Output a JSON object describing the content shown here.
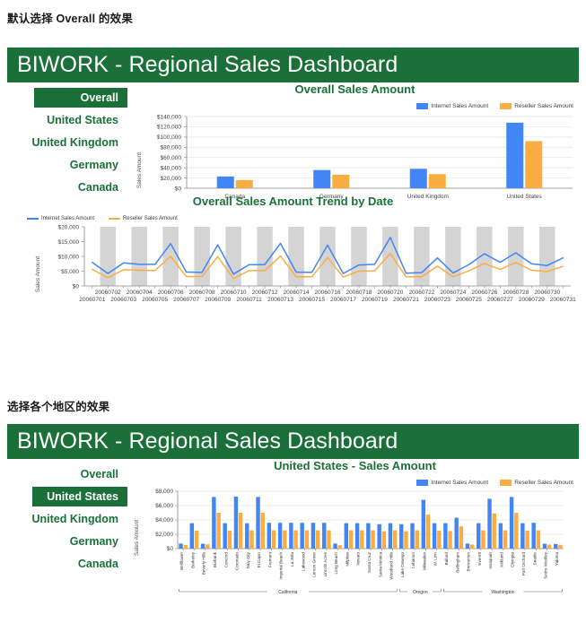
{
  "captions": {
    "first": "默认选择 Overall 的效果",
    "second": "选择各个地区的效果"
  },
  "dashboard_title": "BIWORK - Regional Sales Dashboard",
  "colors": {
    "brand_green": "#1a7038",
    "internet_blue": "#4285f4",
    "reseller_orange": "#fbad41",
    "band_gray": "#d4d4d4"
  },
  "nav": {
    "items": [
      "Overall",
      "United States",
      "United Kingdom",
      "Germany",
      "Canada"
    ],
    "selected_first": "Overall",
    "selected_second": "United States"
  },
  "legend": {
    "internet": "Internet Sales Amount",
    "reseller": "Reseller Sales Amount"
  },
  "axis": {
    "sales_amount": "Sales Amount"
  },
  "chart_data": [
    {
      "type": "bar",
      "title": "Overall Sales Amount",
      "xlabel": "",
      "ylabel": "Sales Amount",
      "ylim": [
        0,
        140000
      ],
      "yticks": [
        "$0",
        "$20,000",
        "$40,000",
        "$60,000",
        "$80,000",
        "$100,000",
        "$120,000",
        "$140,000"
      ],
      "ytick_values": [
        0,
        20000,
        40000,
        60000,
        80000,
        100000,
        120000,
        140000
      ],
      "grid": true,
      "legend_position": "top-right",
      "categories": [
        "Canada",
        "Germany",
        "United Kingdom",
        "United States"
      ],
      "series": [
        {
          "name": "Internet Sales Amount",
          "color": "#4285f4",
          "values": [
            23000,
            35500,
            38000,
            128000
          ]
        },
        {
          "name": "Reseller Sales Amount",
          "color": "#fbad41",
          "values": [
            16000,
            26500,
            27500,
            92000
          ]
        }
      ]
    },
    {
      "type": "line",
      "title": "Overall Sales Amount Trend by Date",
      "xlabel": "",
      "ylabel": "Sales Amount",
      "ylim": [
        0,
        20000
      ],
      "yticks": [
        "$0",
        "$5,000",
        "$10,000",
        "$15,000",
        "$20,000"
      ],
      "ytick_values": [
        0,
        5000,
        10000,
        15000,
        20000
      ],
      "grid": true,
      "legend_position": "top-left",
      "x": [
        "20060701",
        "20060702",
        "20060703",
        "20060704",
        "20060705",
        "20060706",
        "20060707",
        "20060708",
        "20060709",
        "20060710",
        "20060711",
        "20060712",
        "20060713",
        "20060714",
        "20060715",
        "20060716",
        "20060717",
        "20060718",
        "20060719",
        "20060720",
        "20060721",
        "20060722",
        "20060723",
        "20060724",
        "20060725",
        "20060726",
        "20060727",
        "20060728",
        "20060729",
        "20060730",
        "20060731"
      ],
      "series": [
        {
          "name": "Internet Sales Amount",
          "color": "#4285f4",
          "values": [
            8000,
            4200,
            7800,
            7300,
            7300,
            14300,
            4700,
            4600,
            13900,
            4000,
            7200,
            7200,
            14400,
            4700,
            4600,
            13800,
            4200,
            7100,
            7300,
            16400,
            4300,
            4500,
            9500,
            4400,
            7200,
            10900,
            8000,
            11200,
            7500,
            6900,
            9500
          ]
        },
        {
          "name": "Reseller Sales Amount",
          "color": "#fbad41",
          "values": [
            5600,
            2800,
            5500,
            5300,
            5200,
            10000,
            3200,
            3200,
            9900,
            2500,
            5200,
            5200,
            10100,
            3100,
            3100,
            9600,
            3000,
            5000,
            5100,
            11000,
            3100,
            3100,
            6700,
            3100,
            5100,
            7600,
            5600,
            7900,
            5300,
            4900,
            6600
          ]
        }
      ]
    },
    {
      "type": "bar",
      "title": "United States - Sales Amount",
      "xlabel": "",
      "ylabel": "Sales Amount",
      "ylim": [
        0,
        8000
      ],
      "yticks": [
        "$0",
        "$2,000",
        "$4,000",
        "$6,000",
        "$8,000"
      ],
      "ytick_values": [
        0,
        2000,
        4000,
        6000,
        8000
      ],
      "grid": true,
      "legend_position": "top-right",
      "categories": [
        "Bellflower",
        "Berkeley",
        "Beverly Hills",
        "Burbank",
        "Concord",
        "Coronado",
        "Daly City",
        "El Cajon",
        "Fremont",
        "Imperial Beach",
        "La Jolla",
        "Lakewood",
        "Lemon Grove",
        "Lincoln Acres",
        "Long Beach",
        "Milpitas",
        "Novato",
        "Santa Cruz",
        "Santa Monica",
        "Woodland Hills",
        "Lake Oswego",
        "Lebanon",
        "Milwaukie",
        "W. Linn",
        "Ballard",
        "Bellingham",
        "Bremerton",
        "Everett",
        "Issaquah",
        "Kirkland",
        "Olympia",
        "Port Orchard",
        "Seattle",
        "Sedro Woolley",
        "Yakima"
      ],
      "groups": [
        {
          "label": "California",
          "start": 0,
          "end": 19
        },
        {
          "label": "Oregon",
          "start": 20,
          "end": 23
        },
        {
          "label": "Washington",
          "start": 24,
          "end": 34
        }
      ],
      "series": [
        {
          "name": "Internet Sales Amount",
          "color": "#4285f4",
          "values": [
            700,
            3550,
            680,
            7200,
            3550,
            7250,
            3550,
            7200,
            3600,
            3600,
            3600,
            3600,
            3600,
            3600,
            700,
            3550,
            3550,
            3550,
            3400,
            3550,
            3400,
            3550,
            6800,
            3550,
            3550,
            4300,
            700,
            3550,
            6950,
            3550,
            7200,
            3550,
            3600,
            680,
            650
          ]
        },
        {
          "name": "Reseller Sales Amount",
          "color": "#fbad41",
          "values": [
            520,
            2500,
            600,
            5000,
            2500,
            5000,
            2550,
            5000,
            2550,
            2550,
            2550,
            2550,
            2550,
            2550,
            480,
            2550,
            2550,
            2550,
            2400,
            2550,
            2400,
            2550,
            4750,
            2500,
            2450,
            3100,
            560,
            2550,
            4900,
            2550,
            5000,
            2500,
            2550,
            560,
            520
          ]
        }
      ]
    }
  ]
}
